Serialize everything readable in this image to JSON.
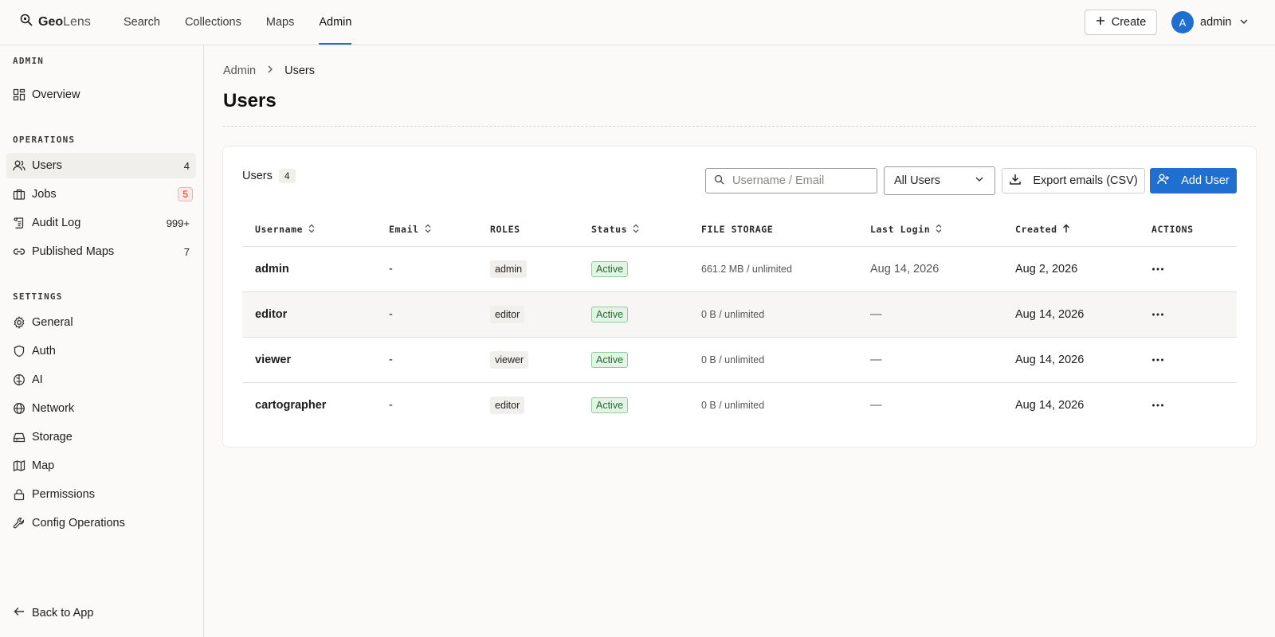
{
  "app": {
    "logo_bold": "Geo",
    "logo_light": "Lens"
  },
  "topnav": {
    "links": [
      {
        "label": "Search",
        "active": false
      },
      {
        "label": "Collections",
        "active": false
      },
      {
        "label": "Maps",
        "active": false
      },
      {
        "label": "Admin",
        "active": true
      }
    ],
    "create_label": "Create",
    "avatar_initial": "A",
    "user_name": "admin"
  },
  "sidebar": {
    "section_admin": "ADMIN",
    "overview": "Overview",
    "section_operations": "OPERATIONS",
    "operations": [
      {
        "label": "Users",
        "count": "4",
        "icon": "users-icon"
      },
      {
        "label": "Jobs",
        "count": "5",
        "icon": "briefcase-icon"
      },
      {
        "label": "Audit Log",
        "count": "999+",
        "icon": "scroll-icon"
      },
      {
        "label": "Published Maps",
        "count": "7",
        "icon": "link-icon"
      }
    ],
    "section_settings": "SETTINGS",
    "settings": [
      {
        "label": "General",
        "icon": "gear-icon"
      },
      {
        "label": "Auth",
        "icon": "shield-icon"
      },
      {
        "label": "AI",
        "icon": "brain-icon"
      },
      {
        "label": "Network",
        "icon": "globe-icon"
      },
      {
        "label": "Storage",
        "icon": "hard-drive-icon"
      },
      {
        "label": "Map",
        "icon": "map-icon"
      },
      {
        "label": "Permissions",
        "icon": "lock-icon"
      },
      {
        "label": "Config Operations",
        "icon": "wrench-icon"
      }
    ],
    "back_label": "Back to App"
  },
  "breadcrumb": {
    "root": "Admin",
    "current": "Users"
  },
  "page_title": "Users",
  "card": {
    "title": "Users",
    "count": "4",
    "search_placeholder": "Username / Email",
    "filter_value": "All Users",
    "export_label": "Export emails (CSV)",
    "add_label": "Add User"
  },
  "table": {
    "headers": {
      "username": "Username",
      "email": "Email",
      "roles": "ROLES",
      "status": "Status",
      "file_storage": "FILE STORAGE",
      "last_login": "Last Login",
      "created": "Created",
      "actions": "ACTIONS"
    },
    "rows": [
      {
        "username": "admin",
        "email": "-",
        "role": "admin",
        "status": "Active",
        "storage": "661.2 MB / unlimited",
        "last_login": "Aug 14, 2026",
        "created": "Aug 2, 2026"
      },
      {
        "username": "editor",
        "email": "-",
        "role": "editor",
        "status": "Active",
        "storage": "0 B / unlimited",
        "last_login": "—",
        "created": "Aug 14, 2026"
      },
      {
        "username": "viewer",
        "email": "-",
        "role": "viewer",
        "status": "Active",
        "storage": "0 B / unlimited",
        "last_login": "—",
        "created": "Aug 14, 2026"
      },
      {
        "username": "cartographer",
        "email": "-",
        "role": "editor",
        "status": "Active",
        "storage": "0 B / unlimited",
        "last_login": "—",
        "created": "Aug 14, 2026"
      }
    ]
  },
  "colors": {
    "accent": "#1f6fd1",
    "status_active_bg": "#e3f4e6",
    "status_active_fg": "#1e6b2c",
    "badge_red": "#c0392b"
  }
}
